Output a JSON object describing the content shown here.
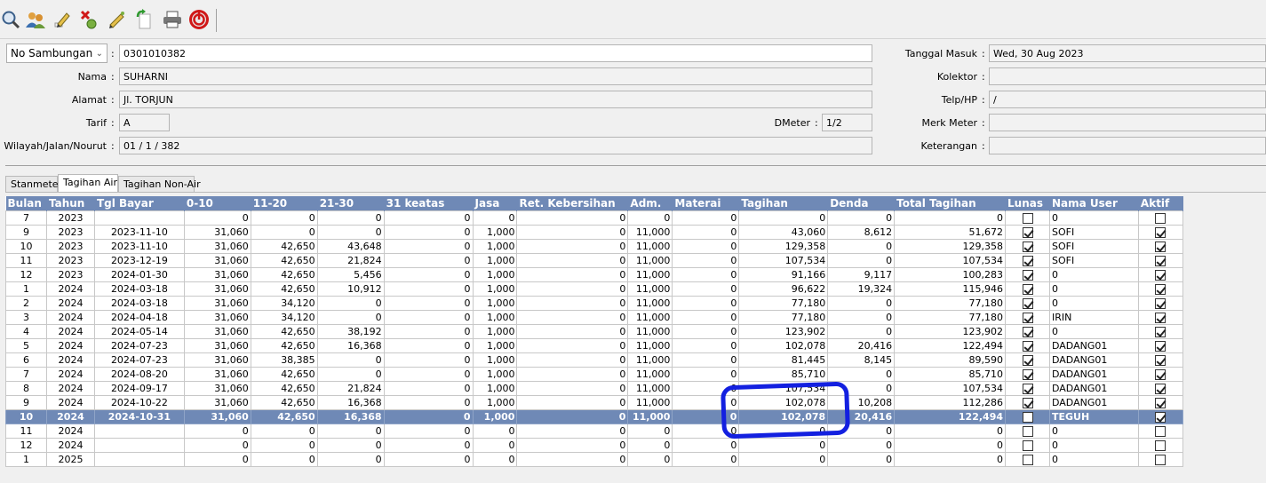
{
  "toolbar": {
    "icons": [
      "search-icon",
      "users-icon",
      "edit-icon",
      "delete-icon",
      "pencil-icon",
      "refresh-icon",
      "print-icon",
      "power-icon"
    ]
  },
  "form": {
    "selector": "No Sambungan",
    "no_sambungan": "0301010382",
    "nama_label": "Nama",
    "nama": "SUHARNI",
    "alamat_label": "Alamat",
    "alamat": "Jl. TORJUN",
    "tarif_label": "Tarif",
    "tarif": "A",
    "dmeter_label": "DMeter",
    "dmeter": "1/2",
    "wilayah_label": "Wilayah/Jalan/Nourut",
    "wilayah": "01 / 1 / 382",
    "tanggal_label": "Tanggal Masuk",
    "tanggal": "Wed, 30 Aug 2023",
    "kolektor_label": "Kolektor",
    "kolektor": "",
    "telp_label": "Telp/HP",
    "telp": "/",
    "merk_label": "Merk Meter",
    "merk": "",
    "ket_label": "Keterangan",
    "ket": ""
  },
  "tabs": [
    "Stanmeter",
    "Tagihan Air",
    "Tagihan Non-Air"
  ],
  "columns": [
    "Bulan",
    "Tahun",
    "Tgl Bayar",
    "0-10",
    "11-20",
    "21-30",
    "31 keatas",
    "Jasa",
    "Ret. Kebersihan",
    "Adm.",
    "Materai",
    "Tagihan",
    "Denda",
    "Total Tagihan",
    "Lunas",
    "Nama User",
    "Aktif"
  ],
  "rows": [
    [
      "7",
      "2023",
      "",
      "0",
      "0",
      "0",
      "0",
      "0",
      "0",
      "0",
      "0",
      "0",
      "0",
      "0",
      false,
      "0",
      false
    ],
    [
      "9",
      "2023",
      "2023-11-10",
      "31,060",
      "0",
      "0",
      "0",
      "1,000",
      "0",
      "11,000",
      "0",
      "43,060",
      "8,612",
      "51,672",
      true,
      "SOFI",
      true
    ],
    [
      "10",
      "2023",
      "2023-11-10",
      "31,060",
      "42,650",
      "43,648",
      "0",
      "1,000",
      "0",
      "11,000",
      "0",
      "129,358",
      "0",
      "129,358",
      true,
      "SOFI",
      true
    ],
    [
      "11",
      "2023",
      "2023-12-19",
      "31,060",
      "42,650",
      "21,824",
      "0",
      "1,000",
      "0",
      "11,000",
      "0",
      "107,534",
      "0",
      "107,534",
      true,
      "SOFI",
      true
    ],
    [
      "12",
      "2023",
      "2024-01-30",
      "31,060",
      "42,650",
      "5,456",
      "0",
      "1,000",
      "0",
      "11,000",
      "0",
      "91,166",
      "9,117",
      "100,283",
      true,
      "0",
      true
    ],
    [
      "1",
      "2024",
      "2024-03-18",
      "31,060",
      "42,650",
      "10,912",
      "0",
      "1,000",
      "0",
      "11,000",
      "0",
      "96,622",
      "19,324",
      "115,946",
      true,
      "0",
      true
    ],
    [
      "2",
      "2024",
      "2024-03-18",
      "31,060",
      "34,120",
      "0",
      "0",
      "1,000",
      "0",
      "11,000",
      "0",
      "77,180",
      "0",
      "77,180",
      true,
      "0",
      true
    ],
    [
      "3",
      "2024",
      "2024-04-18",
      "31,060",
      "34,120",
      "0",
      "0",
      "1,000",
      "0",
      "11,000",
      "0",
      "77,180",
      "0",
      "77,180",
      true,
      "IRIN",
      true
    ],
    [
      "4",
      "2024",
      "2024-05-14",
      "31,060",
      "42,650",
      "38,192",
      "0",
      "1,000",
      "0",
      "11,000",
      "0",
      "123,902",
      "0",
      "123,902",
      true,
      "0",
      true
    ],
    [
      "5",
      "2024",
      "2024-07-23",
      "31,060",
      "42,650",
      "16,368",
      "0",
      "1,000",
      "0",
      "11,000",
      "0",
      "102,078",
      "20,416",
      "122,494",
      true,
      "DADANG01",
      true
    ],
    [
      "6",
      "2024",
      "2024-07-23",
      "31,060",
      "38,385",
      "0",
      "0",
      "1,000",
      "0",
      "11,000",
      "0",
      "81,445",
      "8,145",
      "89,590",
      true,
      "DADANG01",
      true
    ],
    [
      "7",
      "2024",
      "2024-08-20",
      "31,060",
      "42,650",
      "0",
      "0",
      "1,000",
      "0",
      "11,000",
      "0",
      "85,710",
      "0",
      "85,710",
      true,
      "DADANG01",
      true
    ],
    [
      "8",
      "2024",
      "2024-09-17",
      "31,060",
      "42,650",
      "21,824",
      "0",
      "1,000",
      "0",
      "11,000",
      "0",
      "107,534",
      "0",
      "107,534",
      true,
      "DADANG01",
      true
    ],
    [
      "9",
      "2024",
      "2024-10-22",
      "31,060",
      "42,650",
      "16,368",
      "0",
      "1,000",
      "0",
      "11,000",
      "0",
      "102,078",
      "10,208",
      "112,286",
      true,
      "DADANG01",
      true
    ],
    [
      "10",
      "2024",
      "2024-10-31",
      "31,060",
      "42,650",
      "16,368",
      "0",
      "1,000",
      "0",
      "11,000",
      "0",
      "102,078",
      "20,416",
      "122,494",
      false,
      "TEGUH",
      true
    ],
    [
      "11",
      "2024",
      "",
      "0",
      "0",
      "0",
      "0",
      "0",
      "0",
      "0",
      "0",
      "0",
      "0",
      "0",
      false,
      "0",
      false
    ],
    [
      "12",
      "2024",
      "",
      "0",
      "0",
      "0",
      "0",
      "0",
      "0",
      "0",
      "0",
      "0",
      "0",
      "0",
      false,
      "0",
      false
    ],
    [
      "1",
      "2025",
      "",
      "0",
      "0",
      "0",
      "0",
      "0",
      "0",
      "0",
      "0",
      "0",
      "0",
      "0",
      false,
      "0",
      false
    ]
  ],
  "selected_row": 14,
  "colors": {
    "header": "#6f89b6",
    "highlight": "#1320e0",
    "power": "#d01818"
  }
}
